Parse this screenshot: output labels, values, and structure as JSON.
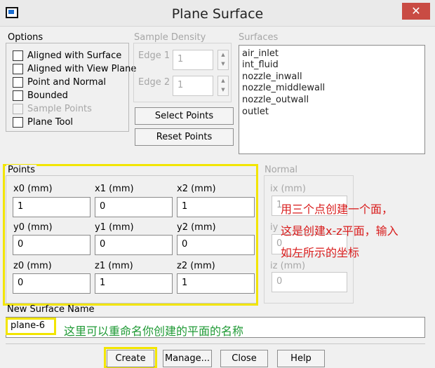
{
  "window": {
    "title": "Plane Surface",
    "close_glyph": "✕"
  },
  "options": {
    "label": "Options",
    "items": [
      {
        "label": "Aligned with Surface",
        "checked": false,
        "enabled": true
      },
      {
        "label": "Aligned with View Plane",
        "checked": false,
        "enabled": true
      },
      {
        "label": "Point and Normal",
        "checked": false,
        "enabled": true
      },
      {
        "label": "Bounded",
        "checked": false,
        "enabled": true
      },
      {
        "label": "Sample Points",
        "checked": false,
        "enabled": false
      },
      {
        "label": "Plane Tool",
        "checked": false,
        "enabled": true
      }
    ]
  },
  "sample_density": {
    "label": "Sample Density",
    "edge1": {
      "label": "Edge 1",
      "value": "1"
    },
    "edge2": {
      "label": "Edge 2",
      "value": "1"
    }
  },
  "buttons": {
    "select_points": "Select Points",
    "reset_points": "Reset Points"
  },
  "surfaces": {
    "label": "Surfaces",
    "items": [
      "air_inlet",
      "int_fluid",
      "nozzle_inwall",
      "nozzle_middlewall",
      "nozzle_outwall",
      "outlet"
    ]
  },
  "points": {
    "label": "Points",
    "x0": {
      "label": "x0 (mm)",
      "value": "1"
    },
    "x1": {
      "label": "x1 (mm)",
      "value": "0"
    },
    "x2": {
      "label": "x2 (mm)",
      "value": "1"
    },
    "y0": {
      "label": "y0 (mm)",
      "value": "0"
    },
    "y1": {
      "label": "y1 (mm)",
      "value": "0"
    },
    "y2": {
      "label": "y2 (mm)",
      "value": "0"
    },
    "z0": {
      "label": "z0 (mm)",
      "value": "0"
    },
    "z1": {
      "label": "z1 (mm)",
      "value": "1"
    },
    "z2": {
      "label": "z2 (mm)",
      "value": "1"
    }
  },
  "normal": {
    "label": "Normal",
    "ix": {
      "label": "ix (mm)",
      "value": "1"
    },
    "iy": {
      "label": "iy",
      "value": "0"
    },
    "iz": {
      "label": "iz (mm)",
      "value": "0"
    }
  },
  "new_surface": {
    "label": "New Surface Name",
    "value": "plane-6"
  },
  "footer": {
    "create": "Create",
    "manage": "Manage...",
    "close": "Close",
    "help": "Help"
  },
  "annotations": {
    "note_line1": "用三个点创建一个面，",
    "note_line2": "这是创建x-z平面，输入",
    "note_line3": "如左所示的坐标",
    "rename_note": "这里可以重命名你创建的平面的名称"
  },
  "colors": {
    "highlight": "#f2e500",
    "note_red": "#d81b1b",
    "note_green": "#1f9a35",
    "close_button": "#c94b43"
  }
}
